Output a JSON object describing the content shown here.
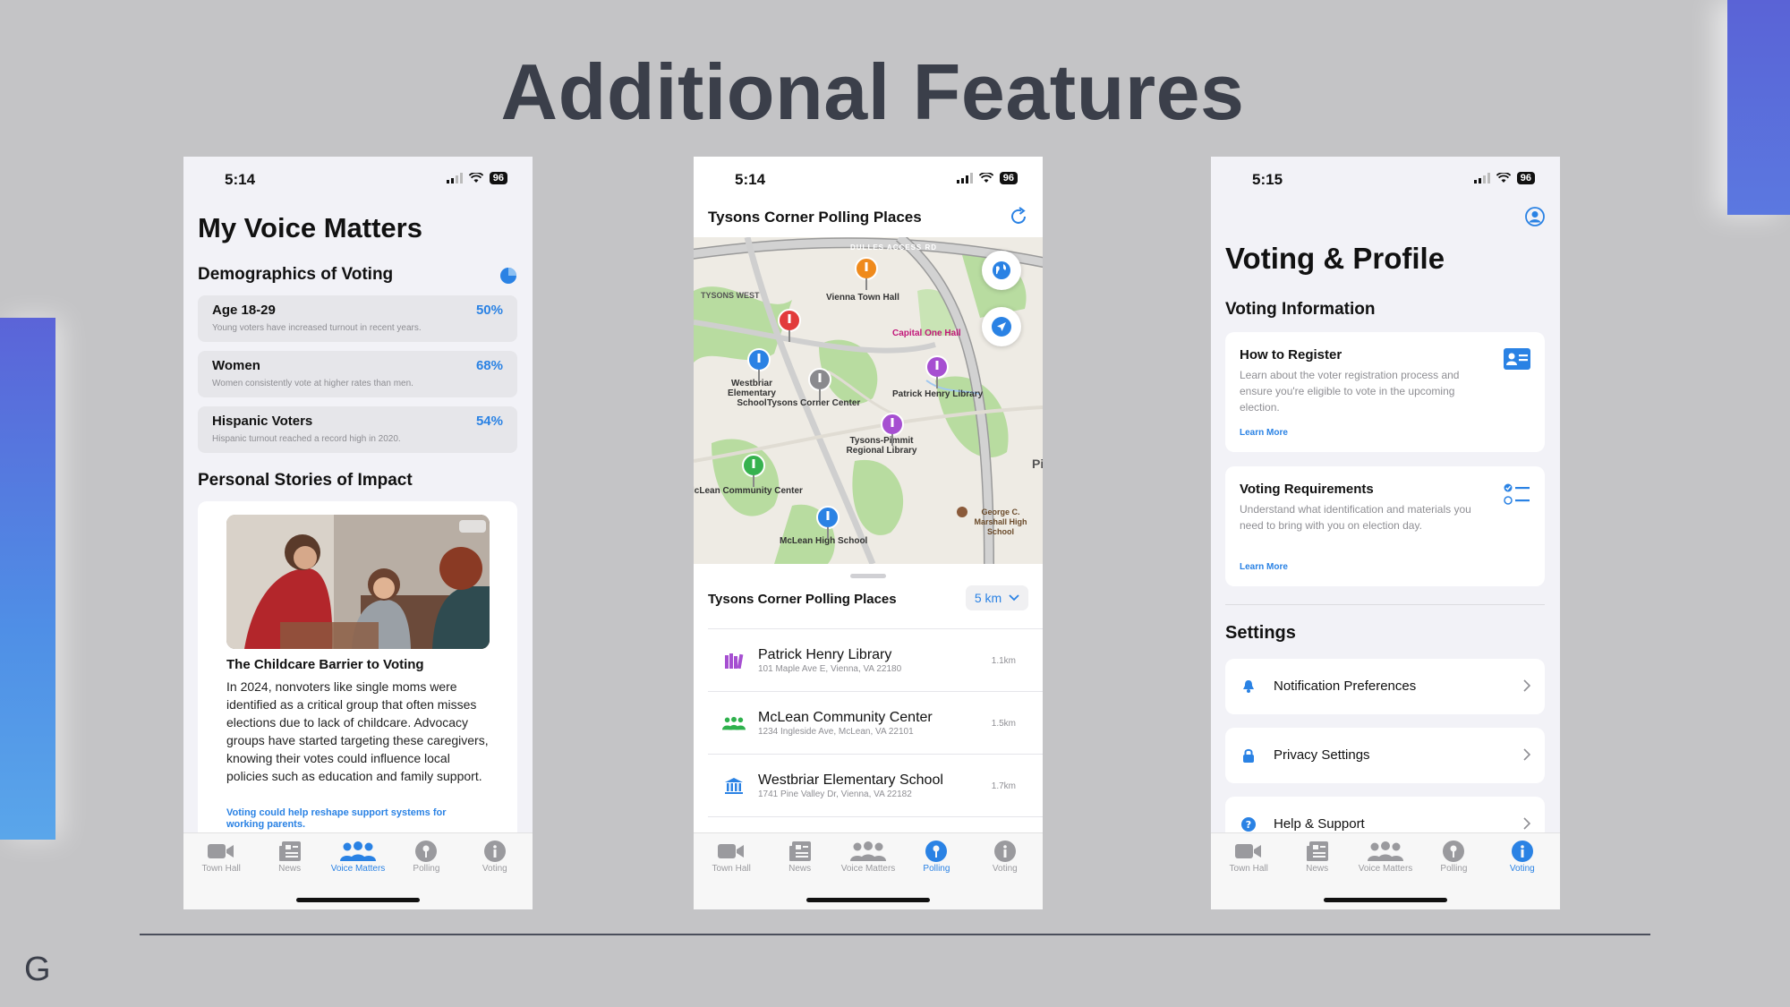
{
  "slide": {
    "title": "Additional Features",
    "brand_letter": "G"
  },
  "phone1": {
    "time": "5:14",
    "battery": "96",
    "title": "My Voice Matters",
    "demographics_title": "Demographics of Voting",
    "demographics": [
      {
        "label": "Age 18-29",
        "pct": "50%",
        "note": "Young voters have increased turnout in recent years."
      },
      {
        "label": "Women",
        "pct": "68%",
        "note": "Women consistently vote at higher rates than men."
      },
      {
        "label": "Hispanic Voters",
        "pct": "54%",
        "note": "Hispanic turnout reached a record high in 2020."
      }
    ],
    "stories_title": "Personal Stories of Impact",
    "story": {
      "headline": "The Childcare Barrier to Voting",
      "body": "In 2024, nonvoters like single moms were identified as a critical group that often misses elections due to lack of childcare. Advocacy groups have started targeting these caregivers, knowing their votes could influence local policies such as education and family support.",
      "link": "Voting could help reshape support systems for working parents."
    },
    "active_tab": "Voice Matters"
  },
  "phone2": {
    "time": "5:14",
    "battery": "96",
    "header": "Tysons Corner Polling Places",
    "map_labels": {
      "road": "DULLES ACCESS RD",
      "tysons_west": "TYSONS WEST",
      "vienna": "Vienna Town Hall",
      "capital_one": "Capital One Hall",
      "westbriar": "Westbriar Elementary School",
      "tysons_center": "Tysons Corner Center",
      "patrick_henry": "Patrick Henry Library",
      "tysons_pimmit": "Tysons-Pimmit Regional Library",
      "mclean_cc": "lcLean Community Center",
      "george_marshall": "George C. Marshall High School",
      "mclean_hs": "McLean High School",
      "edge_text": "Pi"
    },
    "sheet_title": "Tysons Corner Polling Places",
    "distance": "5 km",
    "places": [
      {
        "name": "Patrick Henry Library",
        "address": "101 Maple Ave E, Vienna, VA 22180",
        "distance": "1.1km",
        "icon": "library-icon",
        "color": "#a64fd1"
      },
      {
        "name": "McLean Community Center",
        "address": "1234 Ingleside Ave, McLean, VA 22101",
        "distance": "1.5km",
        "icon": "community-icon",
        "color": "#2fb14d"
      },
      {
        "name": "Westbriar Elementary School",
        "address": "1741 Pine Valley Dr, Vienna, VA 22182",
        "distance": "1.7km",
        "icon": "school-icon",
        "color": "#2a82e4"
      }
    ],
    "active_tab": "Polling"
  },
  "phone3": {
    "time": "5:15",
    "battery": "96",
    "title": "Voting & Profile",
    "info_title": "Voting Information",
    "cards": [
      {
        "title": "How to Register",
        "desc": "Learn about the voter registration process and ensure you're eligible to vote in the upcoming election.",
        "link": "Learn More",
        "icon": "id-card-icon"
      },
      {
        "title": "Voting Requirements",
        "desc": "Understand what identification and materials you need to bring with you on election day.",
        "link": "Learn More",
        "icon": "checklist-icon"
      }
    ],
    "settings_title": "Settings",
    "settings": [
      {
        "label": "Notification Preferences",
        "icon": "bell-icon"
      },
      {
        "label": "Privacy Settings",
        "icon": "lock-icon"
      },
      {
        "label": "Help & Support",
        "icon": "help-icon"
      }
    ],
    "active_tab": "Voting"
  },
  "tabs": [
    "Town Hall",
    "News",
    "Voice Matters",
    "Polling",
    "Voting"
  ],
  "colors": {
    "accent": "#2a82e4",
    "background": "#c4c4c6",
    "title": "#3b3f4a"
  }
}
